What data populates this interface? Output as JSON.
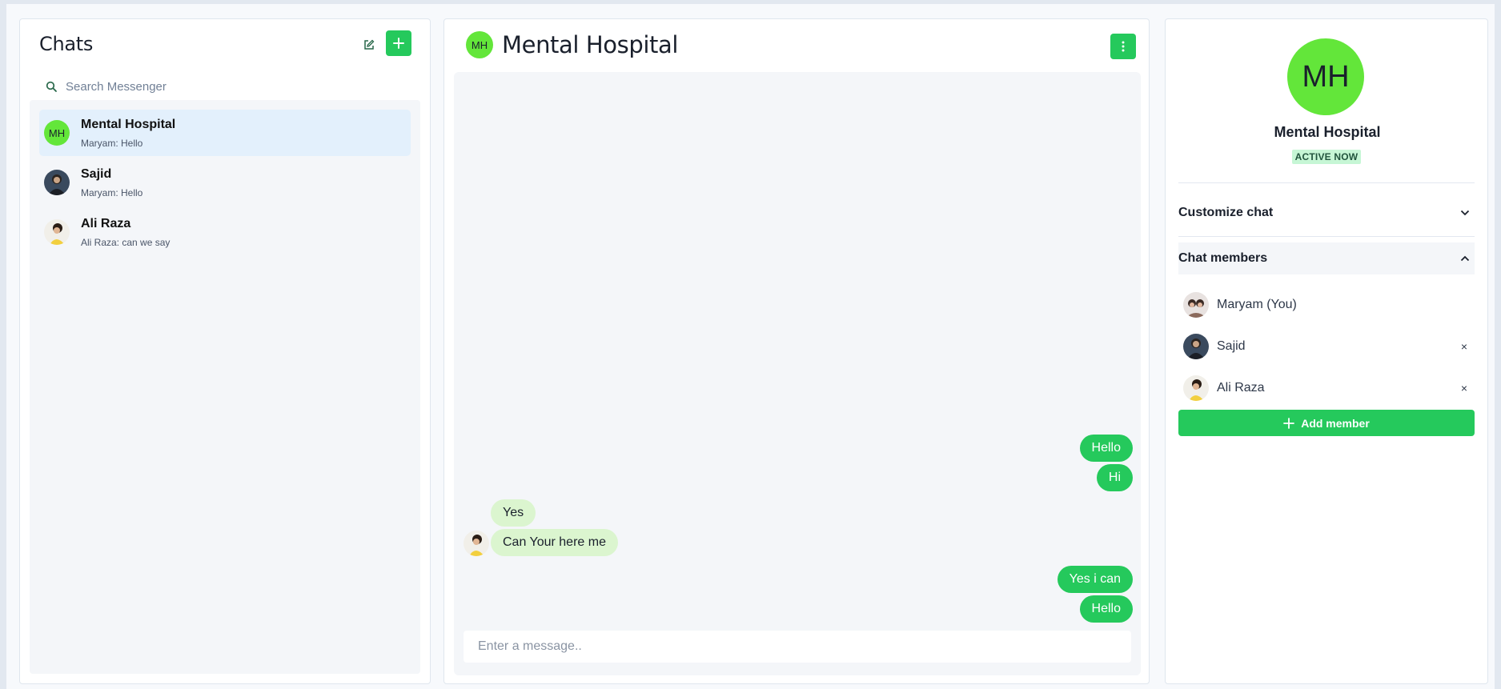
{
  "sidebar": {
    "title": "Chats",
    "search_placeholder": "Search Messenger",
    "chats": [
      {
        "name": "Mental Hospital",
        "preview": "Maryam: Hello",
        "avatar_text": "MH",
        "active": true
      },
      {
        "name": "Sajid",
        "preview": "Maryam: Hello",
        "active": false
      },
      {
        "name": "Ali Raza",
        "preview": "Ali Raza: can we say",
        "active": false
      }
    ]
  },
  "conversation": {
    "title": "Mental Hospital",
    "avatar_text": "MH",
    "messages": [
      {
        "text": "Hello",
        "direction": "outgoing"
      },
      {
        "text": "Hi",
        "direction": "outgoing"
      },
      {
        "text": "Yes",
        "direction": "incoming",
        "sender": "Ali Raza"
      },
      {
        "text": "Can Your here me",
        "direction": "incoming",
        "sender": "Ali Raza"
      },
      {
        "text": "Yes i can",
        "direction": "outgoing"
      },
      {
        "text": "Hello",
        "direction": "outgoing"
      }
    ],
    "composer_placeholder": "Enter a message.."
  },
  "details": {
    "avatar_text": "MH",
    "name": "Mental Hospital",
    "status": "ACTIVE NOW",
    "customize_label": "Customize chat",
    "members_label": "Chat members",
    "members": [
      {
        "name": "Maryam (You)",
        "removable": false
      },
      {
        "name": "Sajid",
        "removable": true
      },
      {
        "name": "Ali Raza",
        "removable": true
      }
    ],
    "remove_glyph": "×",
    "add_member_label": "Add member"
  },
  "colors": {
    "accent": "#25c95c",
    "group_avatar": "#63e63a",
    "active_chat": "#e3f0fc",
    "incoming_bubble": "#dbf5cf",
    "status_badge": "#c6f6d5"
  },
  "icons": {
    "edit": "edit-icon",
    "new_chat": "plus-icon",
    "search": "search-icon",
    "more": "more-vertical-icon",
    "collapse": "chevron-down-icon",
    "expand": "chevron-up-icon",
    "remove": "close-icon",
    "add": "plus-icon"
  }
}
